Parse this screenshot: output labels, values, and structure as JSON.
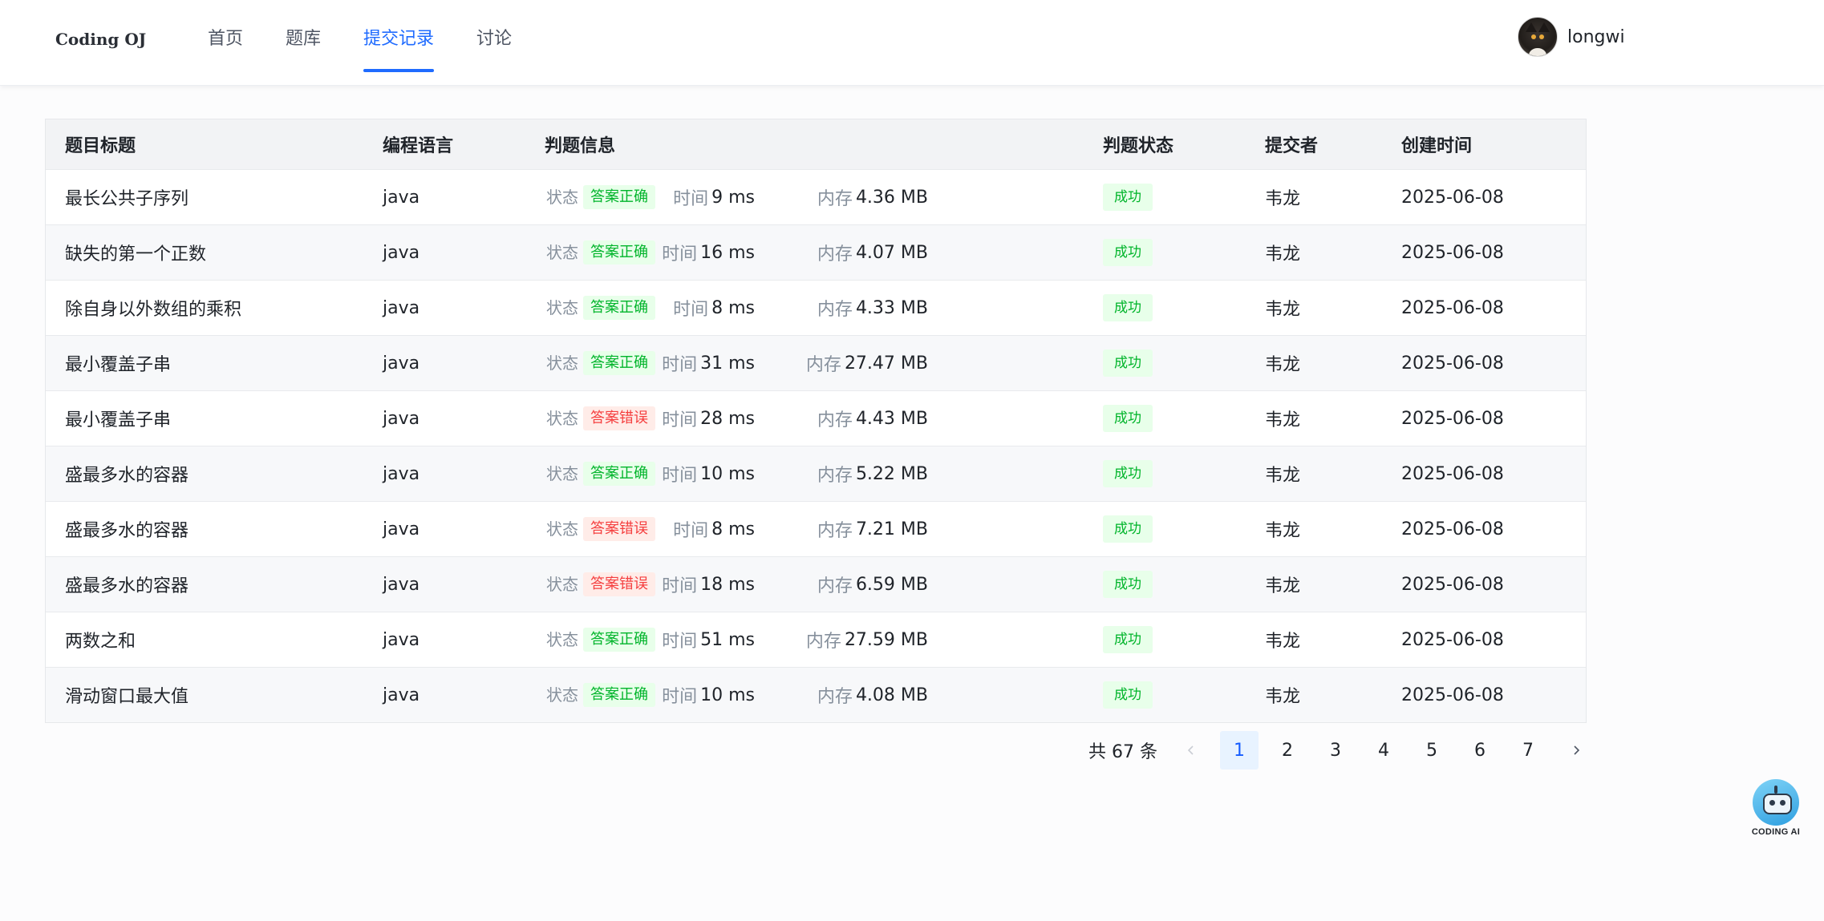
{
  "app": {
    "logo": "Coding OJ"
  },
  "nav": {
    "items": [
      {
        "label": "首页",
        "active": false
      },
      {
        "label": "题库",
        "active": false
      },
      {
        "label": "提交记录",
        "active": true
      },
      {
        "label": "讨论",
        "active": false
      }
    ]
  },
  "user": {
    "name": "longwi",
    "avatar_icon": "cat-avatar"
  },
  "table": {
    "headers": {
      "title": "题目标题",
      "lang": "编程语言",
      "info": "判题信息",
      "status": "判题状态",
      "submitter": "提交者",
      "created": "创建时间"
    },
    "labels": {
      "status": "状态",
      "time": "时间",
      "memory": "内存"
    },
    "rows": [
      {
        "title": "最长公共子序列",
        "lang": "java",
        "result": "答案正确",
        "result_type": "ok",
        "time": "9 ms",
        "memory": "4.36 MB",
        "status": "成功",
        "submitter": "韦龙",
        "created": "2025-06-08"
      },
      {
        "title": "缺失的第一个正数",
        "lang": "java",
        "result": "答案正确",
        "result_type": "ok",
        "time": "16 ms",
        "memory": "4.07 MB",
        "status": "成功",
        "submitter": "韦龙",
        "created": "2025-06-08"
      },
      {
        "title": "除自身以外数组的乘积",
        "lang": "java",
        "result": "答案正确",
        "result_type": "ok",
        "time": "8 ms",
        "memory": "4.33 MB",
        "status": "成功",
        "submitter": "韦龙",
        "created": "2025-06-08"
      },
      {
        "title": "最小覆盖子串",
        "lang": "java",
        "result": "答案正确",
        "result_type": "ok",
        "time": "31 ms",
        "memory": "27.47 MB",
        "status": "成功",
        "submitter": "韦龙",
        "created": "2025-06-08"
      },
      {
        "title": "最小覆盖子串",
        "lang": "java",
        "result": "答案错误",
        "result_type": "err",
        "time": "28 ms",
        "memory": "4.43 MB",
        "status": "成功",
        "submitter": "韦龙",
        "created": "2025-06-08"
      },
      {
        "title": "盛最多水的容器",
        "lang": "java",
        "result": "答案正确",
        "result_type": "ok",
        "time": "10 ms",
        "memory": "5.22 MB",
        "status": "成功",
        "submitter": "韦龙",
        "created": "2025-06-08"
      },
      {
        "title": "盛最多水的容器",
        "lang": "java",
        "result": "答案错误",
        "result_type": "err",
        "time": "8 ms",
        "memory": "7.21 MB",
        "status": "成功",
        "submitter": "韦龙",
        "created": "2025-06-08"
      },
      {
        "title": "盛最多水的容器",
        "lang": "java",
        "result": "答案错误",
        "result_type": "err",
        "time": "18 ms",
        "memory": "6.59 MB",
        "status": "成功",
        "submitter": "韦龙",
        "created": "2025-06-08"
      },
      {
        "title": "两数之和",
        "lang": "java",
        "result": "答案正确",
        "result_type": "ok",
        "time": "51 ms",
        "memory": "27.59 MB",
        "status": "成功",
        "submitter": "韦龙",
        "created": "2025-06-08"
      },
      {
        "title": "滑动窗口最大值",
        "lang": "java",
        "result": "答案正确",
        "result_type": "ok",
        "time": "10 ms",
        "memory": "4.08 MB",
        "status": "成功",
        "submitter": "韦龙",
        "created": "2025-06-08"
      }
    ]
  },
  "pagination": {
    "total_text": "共 67 条",
    "pages": [
      "1",
      "2",
      "3",
      "4",
      "5",
      "6",
      "7"
    ],
    "current": "1",
    "prev_icon": "chevron-left-icon",
    "next_icon": "chevron-right-icon"
  },
  "ai": {
    "label": "CODING AI",
    "icon": "robot-icon"
  },
  "colors": {
    "accent": "#1f6bff",
    "success_bg": "#e8ffea",
    "success_text": "#00b42a",
    "error_bg": "#ffece8",
    "error_text": "#f53f3f"
  }
}
